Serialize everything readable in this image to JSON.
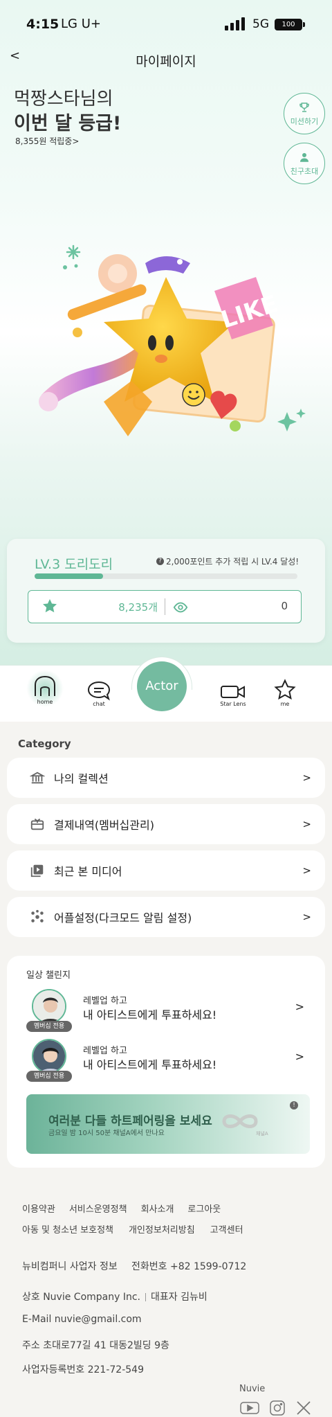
{
  "status_bar": {
    "time": "4:15",
    "carrier": "LG U+",
    "network": "5G",
    "battery": "100"
  },
  "header": {
    "back": "<",
    "title": "마이페이지"
  },
  "greeting": {
    "line1": "먹짱스타님의",
    "line2": "이번 달 등급!",
    "points_link": "8,355원 적립중>"
  },
  "side_buttons": {
    "mission": "미션하기",
    "invite": "친구초대"
  },
  "level": {
    "name": "LV.3 도리도리",
    "hint": "2,000포인트 추가 적립 시 LV.4 달성!",
    "progress": 0.26,
    "star_count": "8,235개",
    "views": "0"
  },
  "tabbar": {
    "home": "home",
    "chat": "chat",
    "actor": "Actor",
    "star_lens": "Star Lens",
    "me": "me"
  },
  "category": {
    "title": "Category",
    "items": [
      {
        "label": "나의 컬렉션",
        "chevron": ">"
      },
      {
        "label": "결제내역(멤버십관리)",
        "chevron": ">"
      },
      {
        "label": "최근 본 미디어",
        "chevron": ">"
      },
      {
        "label": "어플설정(다크모드 알림 설정)",
        "chevron": ">"
      }
    ]
  },
  "challenge": {
    "title": "일상 챌린지",
    "rows": [
      {
        "badge": "멤버십 전용",
        "sub": "레벨업 하고",
        "main": "내 아티스트에게 투표하세요!",
        "chevron": ">"
      },
      {
        "badge": "멤버십 전용",
        "sub": "레벨업 하고",
        "main": "내 아티스트에게 투표하세요!",
        "chevron": ">"
      }
    ],
    "banner": {
      "title": "여러분 다들 하트페어링을 보세요",
      "subtitle": "금요일 밤 10시 50분 채널A에서 만나요",
      "logo_text": "채널A",
      "info": "!"
    }
  },
  "footer": {
    "links_row1": [
      "이용약관",
      "서비스운영정책",
      "회사소개",
      "로그아웃"
    ],
    "links_row2": [
      "아동 및 청소년 보호정책",
      "개인정보처리방침",
      "고객센터"
    ],
    "company_info": "뉴비컴퍼니 사업자 정보",
    "phone": "전화번호 +82 1599-0712",
    "company_name": "상호 Nuvie Company Inc.",
    "ceo": "대표자 김뉴비",
    "email": "E-Mail nuvie@gmail.com",
    "address": "주소 초대로77길 41 대동2빌딩 9층",
    "business_no": "사업자등록번호 221-72-549",
    "brand": "Nuvie"
  },
  "colors": {
    "accent": "#5fb795",
    "actor_button": "#74bba0"
  }
}
